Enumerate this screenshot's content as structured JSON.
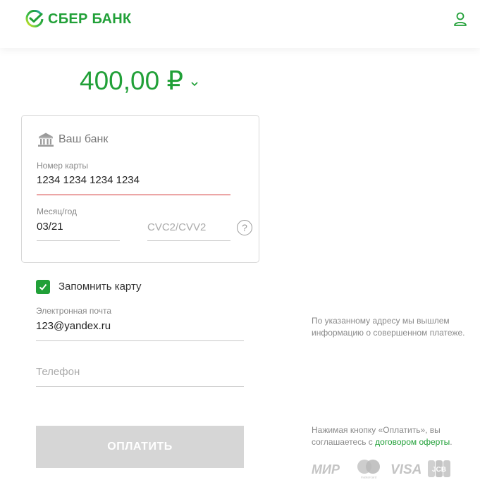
{
  "header": {
    "brand": "СБЕР БАНК",
    "brand_color": "#21a038"
  },
  "payment": {
    "amount": "400,00 ₽"
  },
  "card_form": {
    "bank_label": "Ваш банк",
    "card_number_label": "Номер карты",
    "card_number_value": "1234 1234 1234 1234",
    "expiry_label": "Месяц/год",
    "expiry_value": "03/21",
    "cvc_placeholder": "CVC2/CVV2",
    "help_symbol": "?"
  },
  "remember_card": {
    "label": "Запомнить карту",
    "checked": true
  },
  "contact": {
    "email_label": "Электронная почта",
    "email_value": "123@yandex.ru",
    "phone_placeholder": "Телефон"
  },
  "pay_button": {
    "label": "ОПЛАТИТЬ"
  },
  "notes": {
    "email_note": "По указанному адресу мы вышлем информацию о совершенном платеже.",
    "agreement_prefix": "Нажимая кнопку «Оплатить», вы соглашаетесь с ",
    "agreement_link": "договором оферты",
    "agreement_suffix": "."
  },
  "payment_systems": {
    "mir": "МИР",
    "mastercard": "mastercard",
    "visa": "VISA",
    "jcb": "JCB"
  },
  "icons": [
    "sber-logo-icon",
    "user-icon",
    "chevron-down-icon",
    "bank-icon",
    "help-icon",
    "check-icon"
  ]
}
